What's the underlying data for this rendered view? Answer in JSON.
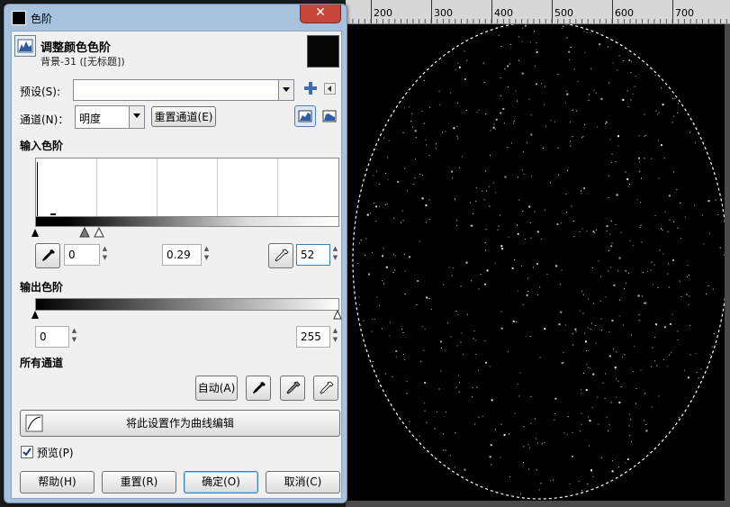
{
  "window": {
    "title": "色阶",
    "close_label": "✕"
  },
  "header": {
    "title": "调整颜色色阶",
    "subtitle": "背景-31 ([无标题])"
  },
  "preset": {
    "label": "预设(S):",
    "value": ""
  },
  "channel": {
    "label": "通道(N)：",
    "value": "明度",
    "reset_label": "重置通道(E)"
  },
  "input_levels": {
    "section_label": "输入色阶",
    "black_value": "0",
    "gamma_value": "0.29",
    "white_value": "52"
  },
  "output_levels": {
    "section_label": "输出色阶",
    "low_value": "0",
    "high_value": "255"
  },
  "all_channels": {
    "section_label": "所有通道",
    "auto_label": "自动(A)"
  },
  "curves_button_label": "将此设置作为曲线编辑",
  "preview": {
    "label": "预览(P)",
    "checked": true
  },
  "footer": {
    "help_label": "帮助(H)",
    "reset_label": "重置(R)",
    "ok_label": "确定(O)",
    "cancel_label": "取消(C)"
  },
  "ruler": {
    "labels": [
      "200",
      "300",
      "400",
      "500",
      "600",
      "700"
    ]
  },
  "icons": [
    "levels-icon",
    "add-preset-icon",
    "menu-arrow-icon",
    "linear-histogram-icon",
    "log-histogram-icon",
    "eyedropper-icon",
    "curves-icon"
  ]
}
